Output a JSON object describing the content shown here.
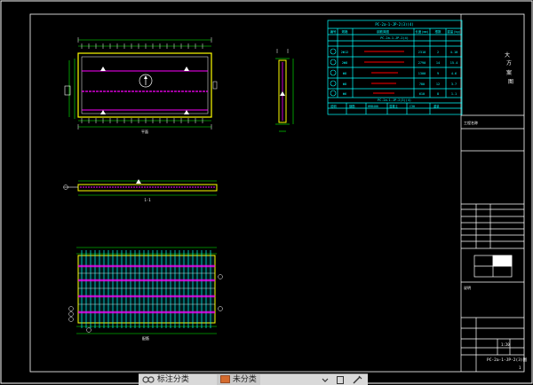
{
  "drawing": {
    "side_title_chars": [
      "大",
      "方",
      "案",
      "图"
    ],
    "table_title": "PC-2a-1-JP-2(3)(4)",
    "table_header": [
      "编号",
      "钢筋简图",
      "规格",
      "长度(mm)",
      "根数",
      "重量(kg)",
      "合计"
    ],
    "table_subtitle": "PC-2a-1-JP-2(4)",
    "table_rows": [
      {
        "mark": "①",
        "code": "2Φ12",
        "len": "2310",
        "qty": "2",
        "wt": "4.10"
      },
      {
        "mark": "②",
        "code": "2Φ8",
        "len": "2790",
        "qty": "14",
        "wt": "15.4"
      },
      {
        "mark": "③",
        "code": "Φ8",
        "len": "1300",
        "qty": "9",
        "wt": "4.6"
      },
      {
        "mark": "④",
        "code": "Φ8",
        "len": "780",
        "qty": "12",
        "wt": "3.7"
      },
      {
        "mark": "⑤",
        "code": "Φ6",
        "len": "610",
        "qty": "8",
        "wt": "1.1"
      }
    ],
    "table_footer": [
      "说明",
      "钢筋",
      "HRB400",
      "混凝土",
      "C30",
      "重量"
    ],
    "table_note": "PC-2a-1-JP-2(3)(4)",
    "section_label": "1-1",
    "plan_label": "平面",
    "rebar_label": "配筋",
    "north_mark": "A",
    "note_label": "说明",
    "title_block_label": "工程名称",
    "scale_label": "1:20",
    "project_name": "PC-2a-1-JP-2(3)图",
    "sheet_no": "1"
  },
  "taskbar": {
    "items": [
      {
        "label": "标注分类",
        "icon": "link-icon"
      },
      {
        "label": "未分类",
        "icon": "folder-icon"
      }
    ],
    "tray_icon": "pen-icon"
  },
  "colors": {
    "background": "#000000",
    "frame": "#ffffff",
    "table": "#00ffff",
    "slab_outline": "#ffff00",
    "rebar_main": "#ff00ff",
    "rebar_dist": "#00ff00",
    "dimension": "#00ff00",
    "rebar_red": "#ff0000",
    "accent": "#d46b2e"
  }
}
